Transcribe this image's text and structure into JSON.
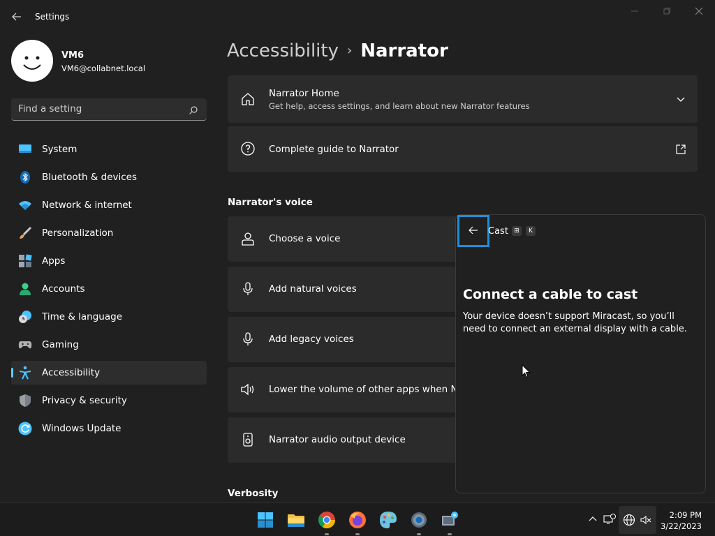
{
  "window": {
    "title": "Settings",
    "icons": {
      "back": "back-arrow-icon",
      "minimize": "minimize-icon",
      "maximize": "maximize-icon",
      "close": "close-icon"
    }
  },
  "profile": {
    "name": "VM6",
    "email": "VM6@collabnet.local"
  },
  "search": {
    "placeholder": "Find a setting",
    "icon": "search-icon"
  },
  "nav": {
    "items": [
      {
        "label": "System",
        "icon": "system-icon",
        "color": "#4cc2ff"
      },
      {
        "label": "Bluetooth & devices",
        "icon": "bluetooth-icon",
        "color": "#0f6cbd"
      },
      {
        "label": "Network & internet",
        "icon": "wifi-icon",
        "color": "#4cc2ff"
      },
      {
        "label": "Personalization",
        "icon": "paintbrush-icon",
        "color": "#e0a060"
      },
      {
        "label": "Apps",
        "icon": "apps-icon",
        "color": "#9aa7b8"
      },
      {
        "label": "Accounts",
        "icon": "accounts-icon",
        "color": "#3ccf8e"
      },
      {
        "label": "Time & language",
        "icon": "clock-globe-icon",
        "color": "#4cc2ff"
      },
      {
        "label": "Gaming",
        "icon": "gamepad-icon",
        "color": "#b0b0b0"
      },
      {
        "label": "Accessibility",
        "icon": "accessibility-icon",
        "color": "#4cc2ff"
      },
      {
        "label": "Privacy & security",
        "icon": "shield-icon",
        "color": "#9aa0a6"
      },
      {
        "label": "Windows Update",
        "icon": "update-icon",
        "color": "#4cc2ff"
      }
    ],
    "active_index": 8
  },
  "breadcrumb": {
    "parent": "Accessibility",
    "separator": "›",
    "current": "Narrator"
  },
  "cards": {
    "home": {
      "title": "Narrator Home",
      "subtitle": "Get help, access settings, and learn about new Narrator features",
      "icon": "home-icon",
      "action_icon": "chevron-down-icon"
    },
    "guide": {
      "title": "Complete guide to Narrator",
      "icon": "help-circle-icon",
      "action_icon": "open-external-icon"
    }
  },
  "sections": {
    "voice": {
      "heading": "Narrator's voice",
      "items": [
        {
          "label": "Choose a voice",
          "icon": "person-icon"
        },
        {
          "label": "Add natural voices",
          "icon": "microphone-icon"
        },
        {
          "label": "Add legacy voices",
          "icon": "microphone-icon"
        },
        {
          "label": "Lower the volume of other apps when Narra",
          "icon": "speaker-icon"
        },
        {
          "label": "Narrator audio output device",
          "icon": "speaker-device-icon"
        }
      ]
    },
    "verbosity": {
      "heading": "Verbosity"
    }
  },
  "flyout": {
    "title": "Cast",
    "shortcut": [
      "⊞",
      "K"
    ],
    "heading": "Connect a cable to cast",
    "body": "Your device doesn’t support Miracast, so you’ll need to connect an external display with a cable.",
    "back_icon": "back-arrow-icon"
  },
  "taskbar": {
    "apps": [
      {
        "name": "start",
        "icon": "windows-logo-icon"
      },
      {
        "name": "file-explorer",
        "icon": "folder-icon"
      },
      {
        "name": "chrome",
        "icon": "chrome-icon"
      },
      {
        "name": "firefox",
        "icon": "firefox-icon"
      },
      {
        "name": "paint",
        "icon": "palette-icon"
      },
      {
        "name": "settings",
        "icon": "gear-icon"
      },
      {
        "name": "remote-desktop",
        "icon": "remote-desktop-icon"
      }
    ],
    "tray": {
      "icons": [
        "chevron-up-icon",
        "display-sync-icon",
        "globe-icon",
        "speaker-muted-icon"
      ],
      "time": "2:09 PM",
      "date": "3/22/2023"
    }
  }
}
